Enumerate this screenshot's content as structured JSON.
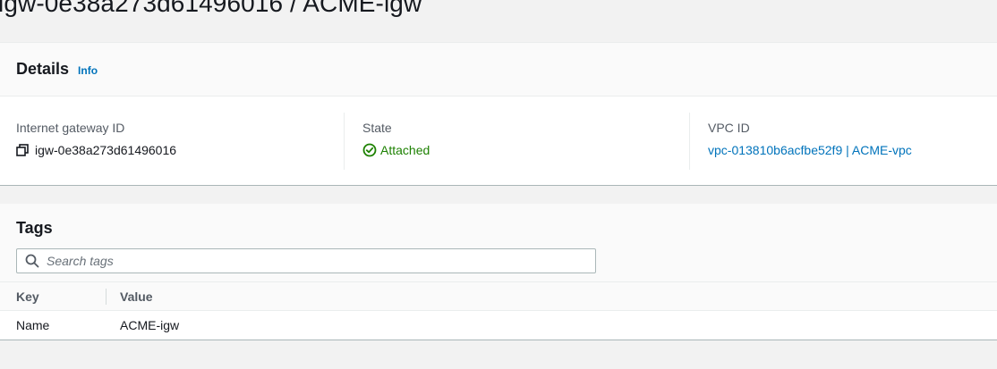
{
  "page": {
    "title": "igw-0e38a273d61496016 / ACME-igw"
  },
  "details": {
    "title": "Details",
    "info_label": "Info",
    "fields": {
      "gateway_id_label": "Internet gateway ID",
      "gateway_id_value": "igw-0e38a273d61496016",
      "state_label": "State",
      "state_value": "Attached",
      "vpc_label": "VPC ID",
      "vpc_value": "vpc-013810b6acfbe52f9 | ACME-vpc"
    }
  },
  "tags": {
    "title": "Tags",
    "search_placeholder": "Search tags",
    "columns": {
      "key": "Key",
      "value": "Value"
    },
    "rows": [
      {
        "key": "Name",
        "value": "ACME-igw"
      }
    ]
  },
  "icons": {
    "copy": "copy-icon",
    "status": "status-positive-icon",
    "search": "search-icon"
  },
  "colors": {
    "link": "#0073bb",
    "success": "#1d8102",
    "text": "#16191f",
    "label": "#545b64"
  }
}
